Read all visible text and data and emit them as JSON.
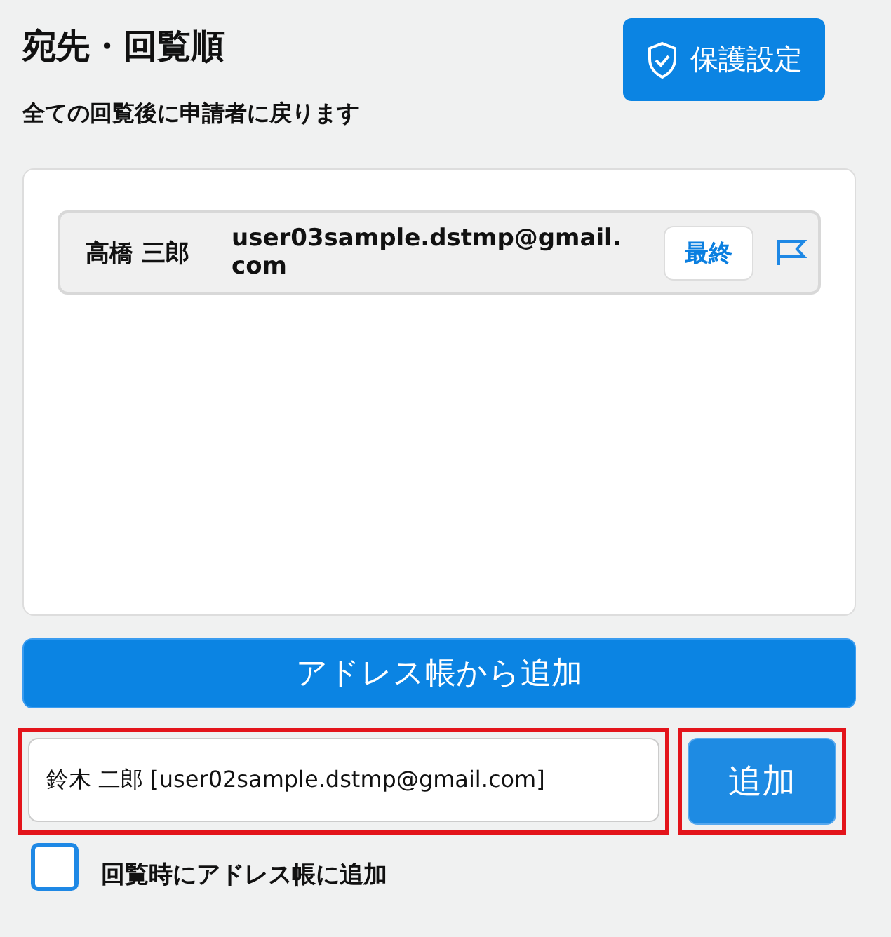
{
  "header": {
    "title": "宛先・回覧順",
    "subtitle": "全ての回覧後に申請者に戻ります",
    "protect_button": "保護設定"
  },
  "recipients": [
    {
      "name": "高橋 三郎",
      "email": "user03sample.dstmp@gmail.com",
      "badge": "最終"
    }
  ],
  "address_book_button": "アドレス帳から追加",
  "entry": {
    "value": "鈴木 二郎 [user02sample.dstmp@gmail.com]",
    "highlighted": true
  },
  "add_button": {
    "label": "追加",
    "highlighted": true
  },
  "save_to_book": {
    "label": "回覧時にアドレス帳に追加",
    "checked": false
  }
}
